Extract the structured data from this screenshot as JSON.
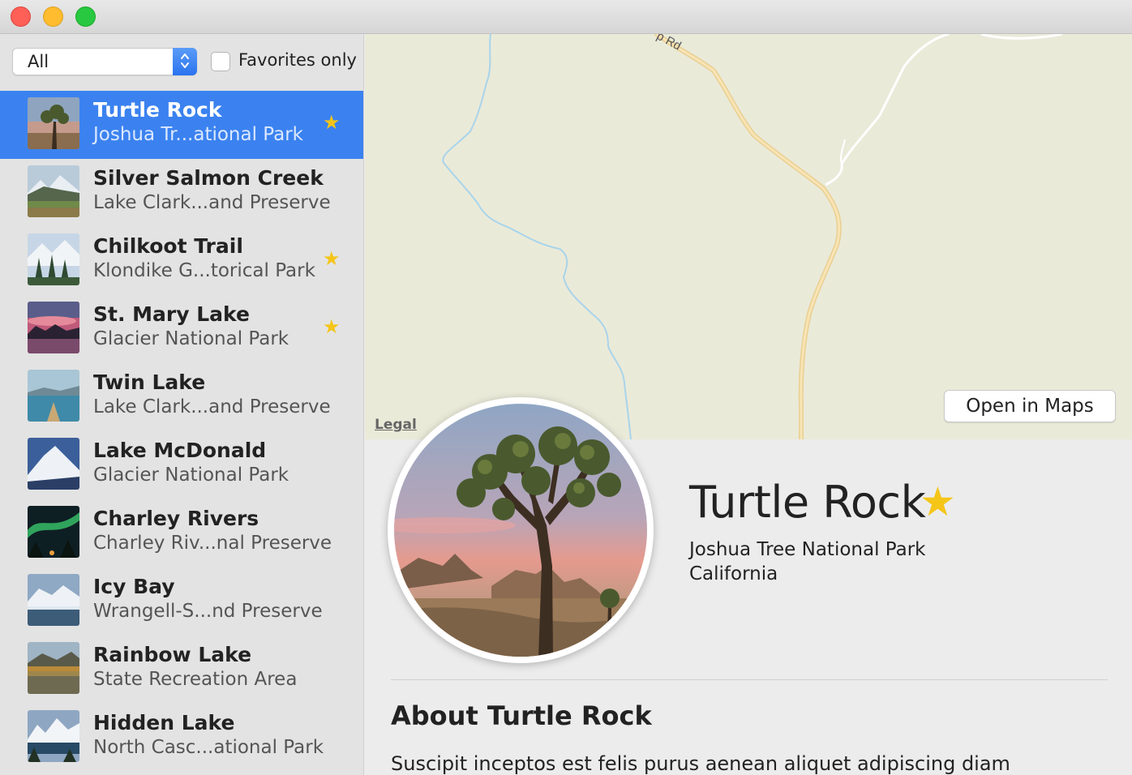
{
  "filter": {
    "selected": "All",
    "favorites_label": "Favorites only",
    "favorites_checked": false
  },
  "colors": {
    "accent": "#3b82f0",
    "star": "#f5c518",
    "sidebar": "#e3e3e3",
    "map_land": "#eaead9",
    "road": "#f6d89a",
    "stream": "#9fcfe6"
  },
  "landmarks": [
    {
      "name": "Turtle Rock",
      "park": "Joshua Tr...ational Park",
      "favorite": true,
      "selected": true,
      "thumb": "desert-tree"
    },
    {
      "name": "Silver Salmon Creek",
      "park": "Lake Clark...and Preserve",
      "favorite": false,
      "selected": false,
      "thumb": "mountain-meadow"
    },
    {
      "name": "Chilkoot Trail",
      "park": "Klondike G...torical Park",
      "favorite": true,
      "selected": false,
      "thumb": "snowy-forest"
    },
    {
      "name": "St. Mary Lake",
      "park": "Glacier National Park",
      "favorite": true,
      "selected": false,
      "thumb": "sunset-lake"
    },
    {
      "name": "Twin Lake",
      "park": "Lake Clark...and Preserve",
      "favorite": false,
      "selected": false,
      "thumb": "canoe-lake"
    },
    {
      "name": "Lake McDonald",
      "park": "Glacier National Park",
      "favorite": false,
      "selected": false,
      "thumb": "snow-peak"
    },
    {
      "name": "Charley Rivers",
      "park": "Charley Riv...nal Preserve",
      "favorite": false,
      "selected": false,
      "thumb": "aurora"
    },
    {
      "name": "Icy Bay",
      "park": "Wrangell-S...nd Preserve",
      "favorite": false,
      "selected": false,
      "thumb": "glacier-bay"
    },
    {
      "name": "Rainbow Lake",
      "park": "State Recreation Area",
      "favorite": false,
      "selected": false,
      "thumb": "reflection-lake"
    },
    {
      "name": "Hidden Lake",
      "park": "North Casc...ational Park",
      "favorite": false,
      "selected": false,
      "thumb": "alpine-lake"
    }
  ],
  "map": {
    "road_label": "p Rd",
    "legal_label": "Legal",
    "open_button": "Open in Maps"
  },
  "detail": {
    "title": "Turtle Rock",
    "favorite": true,
    "park": "Joshua Tree National Park",
    "state": "California",
    "about_heading": "About Turtle Rock",
    "about_text": "Suscipit inceptos est felis purus aenean aliquet adipiscing diam"
  },
  "icons": {
    "star": "★",
    "popup_arrows": "up-down-chevron-icon"
  }
}
